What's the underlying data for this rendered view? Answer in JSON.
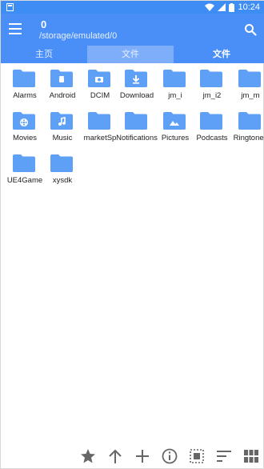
{
  "status": {
    "time": "10:24"
  },
  "header": {
    "title": "0",
    "path": "/storage/emulated/0"
  },
  "tabs": [
    {
      "label": "主页"
    },
    {
      "label": "文件"
    },
    {
      "label": "文件"
    }
  ],
  "folders": [
    {
      "label": "Alarms",
      "icon": "folder-icon"
    },
    {
      "label": "Android",
      "icon": "android-folder-icon"
    },
    {
      "label": "DCIM",
      "icon": "camera-folder-icon"
    },
    {
      "label": "Download",
      "icon": "download-folder-icon"
    },
    {
      "label": "jm_i",
      "icon": "folder-icon"
    },
    {
      "label": "jm_i2",
      "icon": "folder-icon"
    },
    {
      "label": "jm_m",
      "icon": "folder-icon"
    },
    {
      "label": "Movies",
      "icon": "movie-folder-icon"
    },
    {
      "label": "Music",
      "icon": "music-folder-icon"
    },
    {
      "label": "marketSp",
      "icon": "folder-icon"
    },
    {
      "label": "Notifications",
      "icon": "folder-icon"
    },
    {
      "label": "Pictures",
      "icon": "picture-folder-icon"
    },
    {
      "label": "Podcasts",
      "icon": "folder-icon"
    },
    {
      "label": "Ringtones",
      "icon": "folder-icon"
    },
    {
      "label": "UE4Game",
      "icon": "folder-icon"
    },
    {
      "label": "xysdk",
      "icon": "folder-icon"
    }
  ],
  "colors": {
    "accent": "#4a8ff7",
    "folder": "#5ea0f5",
    "icon_grey": "#666666"
  }
}
